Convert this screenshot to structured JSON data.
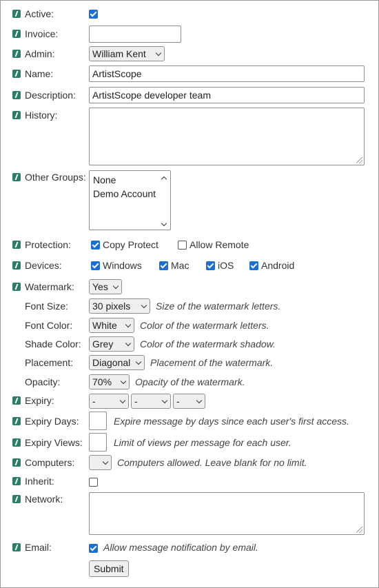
{
  "form": {
    "active": {
      "label": "Active:",
      "checked": true
    },
    "invoice": {
      "label": "Invoice:",
      "value": ""
    },
    "admin": {
      "label": "Admin:",
      "selected": "William Kent"
    },
    "name": {
      "label": "Name:",
      "value": "ArtistScope"
    },
    "description": {
      "label": "Description:",
      "value": "ArtistScope developer team"
    },
    "history": {
      "label": "History:",
      "value": ""
    },
    "other_groups": {
      "label": "Other Groups:",
      "options": [
        "None",
        "Demo Account"
      ]
    },
    "protection": {
      "label": "Protection:",
      "options": [
        {
          "label": "Copy Protect",
          "checked": true
        },
        {
          "label": "Allow Remote",
          "checked": false
        }
      ]
    },
    "devices": {
      "label": "Devices:",
      "options": [
        {
          "label": "Windows",
          "checked": true
        },
        {
          "label": "Mac",
          "checked": true
        },
        {
          "label": "iOS",
          "checked": true
        },
        {
          "label": "Android",
          "checked": true
        }
      ]
    },
    "watermark": {
      "label": "Watermark:",
      "selected": "Yes",
      "font_size": {
        "label": "Font Size:",
        "selected": "30 pixels",
        "hint": "Size of the watermark letters."
      },
      "font_color": {
        "label": "Font Color:",
        "selected": "White",
        "hint": "Color of the watermark letters."
      },
      "shade_color": {
        "label": "Shade Color:",
        "selected": "Grey",
        "hint": "Color of the watermark shadow."
      },
      "placement": {
        "label": "Placement:",
        "selected": "Diagonal",
        "hint": "Placement of the watermark."
      },
      "opacity": {
        "label": "Opacity:",
        "selected": "70%",
        "hint": "Opacity of the watermark."
      }
    },
    "expiry": {
      "label": "Expiry:",
      "selects": [
        "-",
        "-",
        "-"
      ]
    },
    "expiry_days": {
      "label": "Expiry Days:",
      "value": "",
      "hint": "Expire message by days since each user's first access."
    },
    "expiry_views": {
      "label": "Expiry Views:",
      "value": "",
      "hint": "Limit of views per message for each user."
    },
    "computers": {
      "label": "Computers:",
      "selected": "",
      "hint": "Computers allowed. Leave blank for no limit."
    },
    "inherit": {
      "label": "Inherit:",
      "checked": false
    },
    "network": {
      "label": "Network:",
      "value": ""
    },
    "email": {
      "label": "Email:",
      "checked": true,
      "hint": "Allow message notification by email."
    },
    "submit_label": "Submit"
  },
  "colors": {
    "checkbox": "#1a6fd6",
    "help_icon": "#2e7d6a",
    "frame_border": "#9a9a9a"
  },
  "icons": {
    "help": "help-note-icon",
    "dropdown": "chevron-down-icon"
  }
}
